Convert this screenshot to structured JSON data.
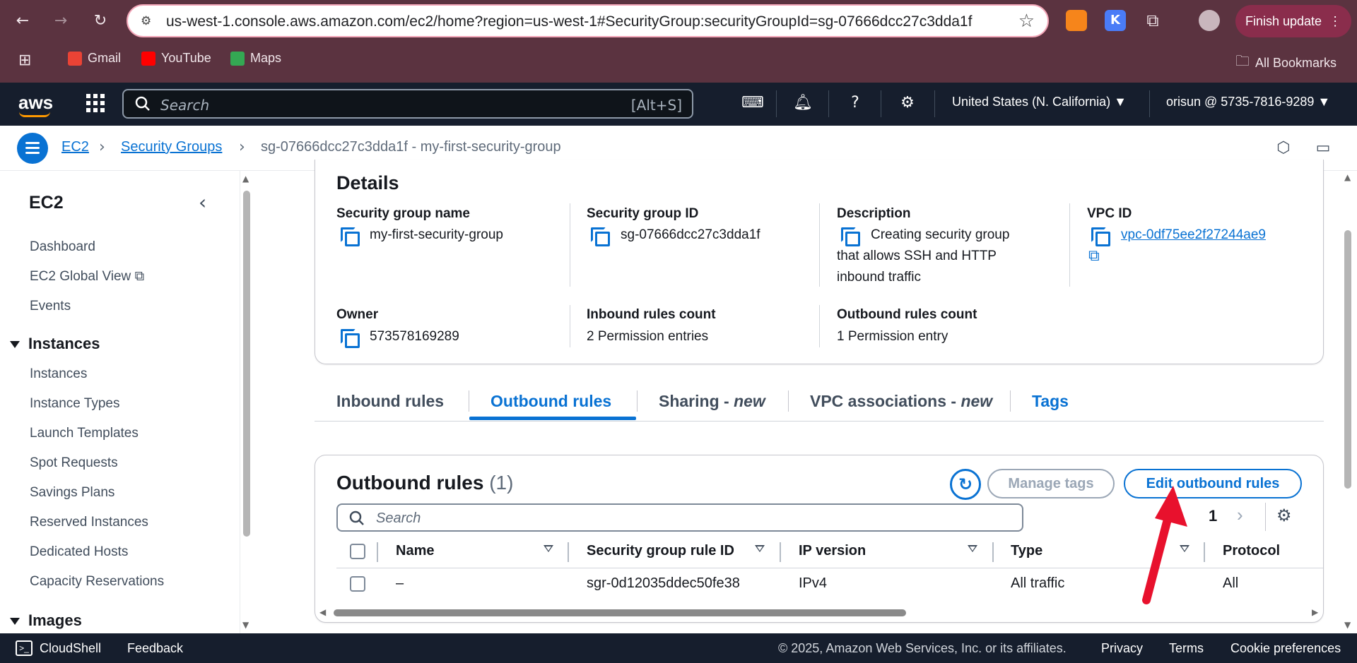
{
  "browser": {
    "url": "us-west-1.console.aws.amazon.com/ec2/home?region=us-west-1#SecurityGroup:securityGroupId=sg-07666dcc27c3dda1f",
    "finish_update": "Finish update",
    "bookmarks": [
      "Gmail",
      "YouTube",
      "Maps"
    ],
    "all_bookmarks": "All Bookmarks"
  },
  "aws_header": {
    "logo": "aws",
    "search_placeholder": "Search",
    "search_shortcut": "[Alt+S]",
    "region": "United States (N. California) ▼",
    "account": "orisun @ 5735-7816-9289 ▼"
  },
  "breadcrumb": {
    "items": [
      "EC2",
      "Security Groups"
    ],
    "current": "sg-07666dcc27c3dda1f - my-first-security-group"
  },
  "sidebar": {
    "title": "EC2",
    "top_items": [
      "Dashboard",
      "EC2 Global View",
      "Events"
    ],
    "instances_section": "Instances",
    "instances_items": [
      "Instances",
      "Instance Types",
      "Launch Templates",
      "Spot Requests",
      "Savings Plans",
      "Reserved Instances",
      "Dedicated Hosts",
      "Capacity Reservations"
    ],
    "images_section": "Images"
  },
  "details": {
    "title": "Details",
    "sg_name_label": "Security group name",
    "sg_name": "my-first-security-group",
    "sg_id_label": "Security group ID",
    "sg_id": "sg-07666dcc27c3dda1f",
    "desc_label": "Description",
    "desc_line1": "Creating security group",
    "desc_line2": "that allows SSH and HTTP",
    "desc_line3": "inbound traffic",
    "vpc_label": "VPC ID",
    "vpc_id": "vpc-0df75ee2f27244ae9",
    "owner_label": "Owner",
    "owner": "573578169289",
    "inbound_count_label": "Inbound rules count",
    "inbound_count": "2 Permission entries",
    "outbound_count_label": "Outbound rules count",
    "outbound_count": "1 Permission entry"
  },
  "tabs": {
    "inbound": "Inbound rules",
    "outbound": "Outbound rules",
    "sharing": "Sharing - ",
    "sharing_new": "new",
    "vpc_assoc": "VPC associations - ",
    "vpc_assoc_new": "new",
    "tags": "Tags"
  },
  "outbound_table": {
    "title": "Outbound rules",
    "count": "(1)",
    "manage_tags": "Manage tags",
    "edit_button": "Edit outbound rules",
    "search_placeholder": "Search",
    "page": "1",
    "columns": [
      "Name",
      "Security group rule ID",
      "IP version",
      "Type",
      "Protocol"
    ],
    "rows": [
      {
        "name": "–",
        "rule_id": "sgr-0d12035ddec50fe38",
        "ip_version": "IPv4",
        "type": "All traffic",
        "protocol": "All"
      }
    ]
  },
  "footer": {
    "cloudshell": "CloudShell",
    "feedback": "Feedback",
    "copyright": "© 2025, Amazon Web Services, Inc. or its affiliates.",
    "privacy": "Privacy",
    "terms": "Terms",
    "cookies": "Cookie preferences"
  },
  "colors": {
    "chrome": "#5b3340",
    "aws_bar": "#161e2d",
    "link": "#0972d3",
    "annotation_arrow": "#e8112d"
  },
  "icons": [
    "back-icon",
    "forward-icon",
    "reload-icon",
    "site-info-icon",
    "star-icon",
    "metamask-icon",
    "extension-k-icon",
    "puzzle-icon",
    "profile-icon",
    "apps-icon",
    "search-icon",
    "cloudshell-icon",
    "bell-icon",
    "help-icon",
    "gear-icon",
    "menu-icon",
    "security-icon",
    "feedback-icon",
    "copy-icon",
    "external-link-icon",
    "refresh-icon",
    "settings-icon"
  ]
}
